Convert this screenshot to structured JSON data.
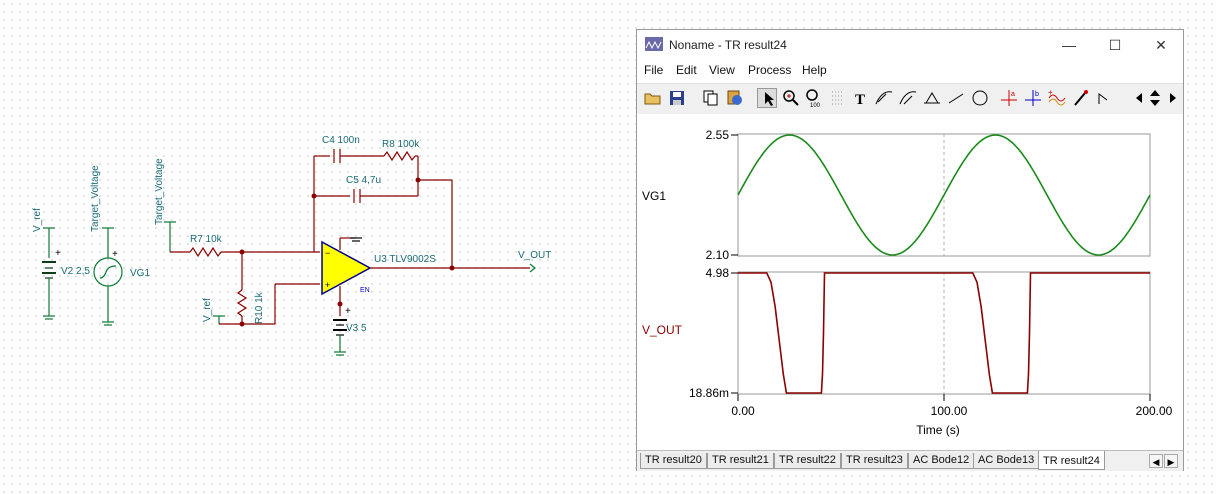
{
  "schematic": {
    "labels": {
      "v_ref_left": "V_ref",
      "target_voltage_left": "Target_Voltage",
      "target_voltage_mid": "Target_Voltage",
      "v_ref_mid": "V_ref",
      "v2": "V2 2,5",
      "vg1": "VG1",
      "r7": "R7 10k",
      "r10": "R10 1k",
      "c4": "C4 100n",
      "r8": "R8 100k",
      "c5": "C5 4,7u",
      "u3": "U3 TLV9002S",
      "en": "EN",
      "v3": "V3 5",
      "v_out": "V_OUT"
    }
  },
  "window": {
    "title": "Noname - TR result24",
    "controls": {
      "minimize": "—",
      "maximize": "☐",
      "close": "✕"
    },
    "menu": [
      "File",
      "Edit",
      "View",
      "Process",
      "Help"
    ],
    "toolbar_icons": [
      "open-icon",
      "save-icon",
      "copy-icon",
      "paste-icon",
      "pointer-icon",
      "zoom-in-icon",
      "zoom-100-icon",
      "grid-icon",
      "text-icon",
      "cursor-a-icon",
      "cursor-b-icon",
      "measure-icon",
      "line-icon",
      "circle-icon",
      "cursor-red-icon",
      "cursor-blue-icon",
      "waveform-icon",
      "probe-icon",
      "marker-icon",
      "arrow-left-icon",
      "arrow-updown-icon",
      "arrow-right-icon"
    ]
  },
  "chart_data": {
    "type": "line",
    "xlabel": "Time (s)",
    "x_ticks": [
      "0.00",
      "100.00",
      "200.00"
    ],
    "xlim": [
      0,
      200
    ],
    "panels": [
      {
        "name": "VG1",
        "color": "#1a8a1a",
        "ylim": [
          2.1,
          2.55
        ],
        "y_ticks": [
          "2.55",
          "2.10"
        ],
        "series": {
          "kind": "sine",
          "offset": 2.325,
          "amplitude": 0.225,
          "period": 100,
          "start_phase_value": 2.325
        }
      },
      {
        "name": "V_OUT",
        "color": "#8b0000",
        "ylim": [
          0.01886,
          4.98
        ],
        "y_ticks": [
          "4.98",
          "18.86m"
        ],
        "series": {
          "x": [
            0,
            14,
            15,
            17,
            19,
            21,
            23,
            40,
            41,
            41.5,
            42,
            200
          ],
          "pulses_note": "",
          "points_period1": [
            [
              0,
              4.98
            ],
            [
              14,
              4.98
            ],
            [
              16,
              4.6
            ],
            [
              18,
              3.6
            ],
            [
              20,
              2.2
            ],
            [
              22,
              0.8
            ],
            [
              23.5,
              0.01886
            ],
            [
              40.5,
              0.01886
            ],
            [
              41,
              0.8
            ],
            [
              41.5,
              2.5
            ],
            [
              42,
              4.98
            ]
          ],
          "points_period2": [
            [
              114,
              4.98
            ],
            [
              116,
              4.6
            ],
            [
              118,
              3.6
            ],
            [
              120,
              2.2
            ],
            [
              122,
              0.8
            ],
            [
              123.5,
              0.01886
            ],
            [
              140.5,
              0.01886
            ],
            [
              141,
              0.8
            ],
            [
              141.5,
              2.5
            ],
            [
              142,
              4.98
            ],
            [
              200,
              4.98
            ]
          ]
        }
      }
    ]
  },
  "tabs": [
    "TR result20",
    "TR result21",
    "TR result22",
    "TR result23",
    "AC Bode12",
    "AC Bode13",
    "TR result24"
  ],
  "active_tab": "TR result24",
  "tab_scroll": {
    "left": "◀",
    "right": "▶"
  }
}
